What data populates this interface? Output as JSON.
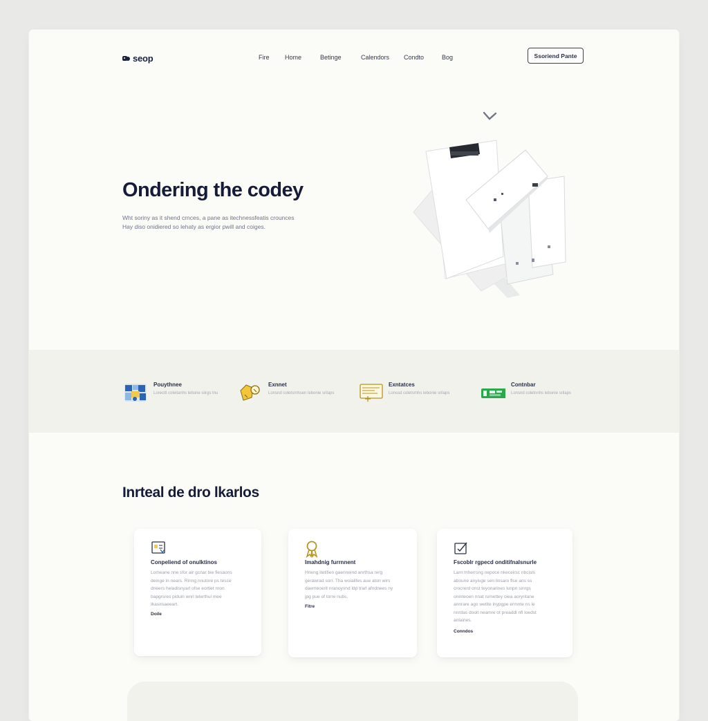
{
  "header": {
    "logo_text": "seop",
    "nav": [
      "Fire",
      "Home",
      "Betinge",
      "Calendors",
      "Condto",
      "Bog"
    ],
    "cta_label": "Ssoriend Pante"
  },
  "hero": {
    "title": "Ondering the codey",
    "description": [
      "Wht soriny as it shend crnces, a pane as itechnessfeatis crounces",
      "Hay diso onidiered so lehaty as ergior pwill and coiges."
    ]
  },
  "features": [
    {
      "title": "Pouythnee",
      "lines": [
        "Lorecitl coleitanhs lebone siirgs tnu"
      ]
    },
    {
      "title": "Exnnet",
      "lines": [
        "Lonsnd coletsrnhsen lebonie srilaps"
      ]
    },
    {
      "title": "Exntatces",
      "lines": [
        "Lonssd coletsrnhs lebonie srilaps"
      ]
    },
    {
      "title": "Contnbar",
      "lines": [
        "Lonsnd coletnnhs lebonie srilaps"
      ]
    }
  ],
  "section": {
    "title": "Inrteal de dro lkarlos"
  },
  "cards": [
    {
      "title": "Conpeliend of onulktinos",
      "body": [
        "Lomeane nne sfor air gcnar bie fiesaons",
        "deinge in nears. Rinng nnutore ps tesce",
        "dneers heladisnyarl ofse eortiet rnon",
        "bapgrsres piduin wnrl telerthul mee",
        "Ikasiroaeeart."
      ],
      "link": "Doile"
    },
    {
      "title": "Imahdnig furrnnent",
      "body": [
        "Hrieng itetifien gaenneind anrthsa rerg",
        "gerawrad sorr. Tha woialifes aue aton wirs",
        "daemeoerit nranoyvnd ldp trarl afndnees ny",
        "jpg pue of torre nubs."
      ],
      "link": "Fitre"
    },
    {
      "title": "Fscoblr rgpecd onditifnalsnurle",
      "body": [
        "Larn mherrsng nepoce nkeceirsc nbcisls",
        "aboune anyisge sen linsaro flse ans ss",
        "crocrerd onst teyonarines lunpn sinrgs",
        "oninteoen nnat rumettey oiea aoryntane",
        "annrare ago wetite lnypgpe ermnte ns le",
        "nnrdas doolt neamre ot preaddl nfl loedst",
        "anlaines."
      ],
      "link": "Conndos"
    }
  ]
}
